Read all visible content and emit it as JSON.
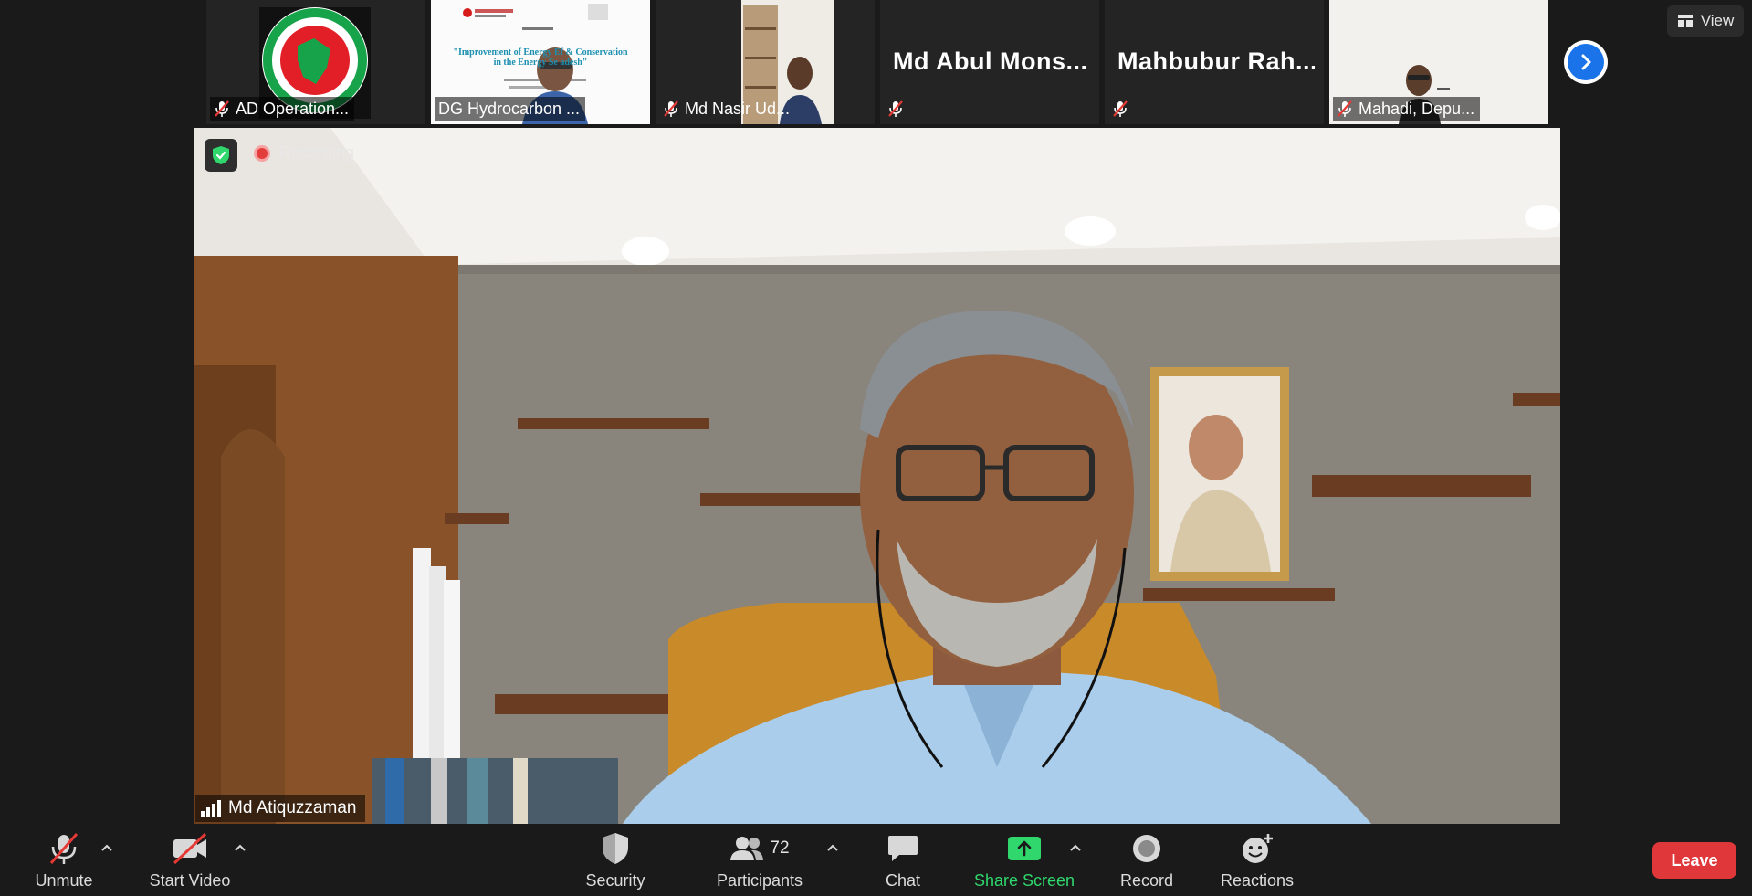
{
  "thumbnails": [
    {
      "name": "AD Operation...",
      "muted": true,
      "kind": "emblem"
    },
    {
      "name": "DG Hydrocarbon ...",
      "muted": false,
      "kind": "slide",
      "slide_title": "\"Improvement of Energy Ef         & Conservation",
      "slide_subtitle": "in the Energy Se          adesh\""
    },
    {
      "name": "Md  Nasir Ud...",
      "muted": true,
      "kind": "video"
    },
    {
      "name": "",
      "display_name": "Md  Abul  Mons...",
      "muted": true,
      "kind": "text"
    },
    {
      "name": "",
      "display_name": "Mahbubur  Rah...",
      "muted": true,
      "kind": "text"
    },
    {
      "name": "Mahadi, Depu...",
      "muted": true,
      "kind": "video"
    }
  ],
  "view_button": {
    "label": "View"
  },
  "next_button": {
    "icon": "chevron-right-icon"
  },
  "main_video": {
    "recording_label": "Recording",
    "speaker_name": "Md Atiquzzaman"
  },
  "toolbar": {
    "unmute": "Unmute",
    "start_video": "Start Video",
    "security": "Security",
    "participants": "Participants",
    "participant_count": "72",
    "chat": "Chat",
    "share_screen": "Share Screen",
    "record": "Record",
    "reactions": "Reactions",
    "leave": "Leave"
  },
  "colors": {
    "accent_blue": "#1a73e8",
    "share_green": "#2fd76c",
    "leave_red": "#e0373a",
    "muted_red": "#e53935"
  }
}
